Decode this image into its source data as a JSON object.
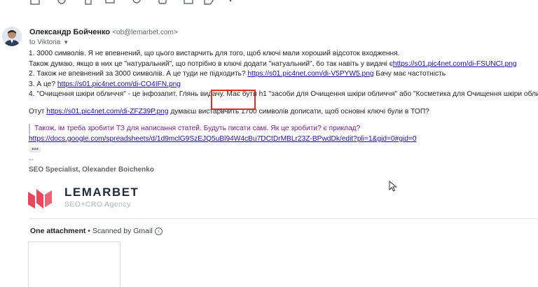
{
  "toolbar": {
    "icons": [
      "archive-icon",
      "report-spam-icon",
      "delete-icon",
      "mark-unread-icon",
      "snooze-icon",
      "add-to-tasks-icon",
      "move-to-icon",
      "label-icon",
      "more-icon"
    ]
  },
  "sender": {
    "name": "Олександр Бойченко",
    "email": "<ob@lemarbet.com>",
    "to": "to Viktoria"
  },
  "message": {
    "line1": "1. 3000 символів. Я не впевнений, що цього вистарчить для того, щоб ключі мали хороший відсоток входження.",
    "line2_text": "Також думаю, якщо в них це \"натуральний\", що потрібно в ключі додати \"натуальний\", бо так навіть у видачі є",
    "line2_link": "https://s01.pic4net.com/di-FSUNCI.png",
    "line3_text": "2. Також не впевнений за 3000 символів. А це туди не підходить? ",
    "line3_link": "https://s01.pic4net.com/di-V5PYW5.png",
    "line3_after": " Бачу має частотність",
    "line4_text": "3. А це? ",
    "line4_link": "https://s01.pic4net.com/di-CO4IFN.png",
    "line5": "4. \"Очищення шкіри обличчя\" - це інфозапит. Глянь видачу. Має бути h1 \"засоби для Очищення шкіри обличчя\" або \"Косметика для Очищення шкіри обличчя\".",
    "line6_text": "Отут ",
    "line6_link": "https://s01.pic4net.com/di-ZFZ39P.png",
    "line6_after": " думаєш вистарвчить 1700 символів дописати, щоб основні ключі були в ТОП?",
    "quote": "Також, ім треба зробити ТЗ для написання статей. Будуть писати самі. Як це зробити? є приклад?",
    "quote_link": "https://docs.google.com/spreadsheets/d/1d9mclG9SzEJQ5uBl94W4cBu7DCtDrMBLr23Z-BPwdDk/edit?pli=1&gid=0#gid=0",
    "dots": "•••",
    "sig_dash": "--",
    "sig_title": "SEO Specialist, Olexander Boichenko"
  },
  "logo": {
    "brand": "LEMARBET",
    "tagline": "SEO+CRO Agency",
    "color": "#e8485c"
  },
  "attachments": {
    "header": "One attachment",
    "sep": " • ",
    "scanned": "Scanned by Gmail"
  },
  "colors": {
    "link": "#1a0dab",
    "quote_text": "#7b1f8f",
    "highlight_box": "#d93025"
  }
}
